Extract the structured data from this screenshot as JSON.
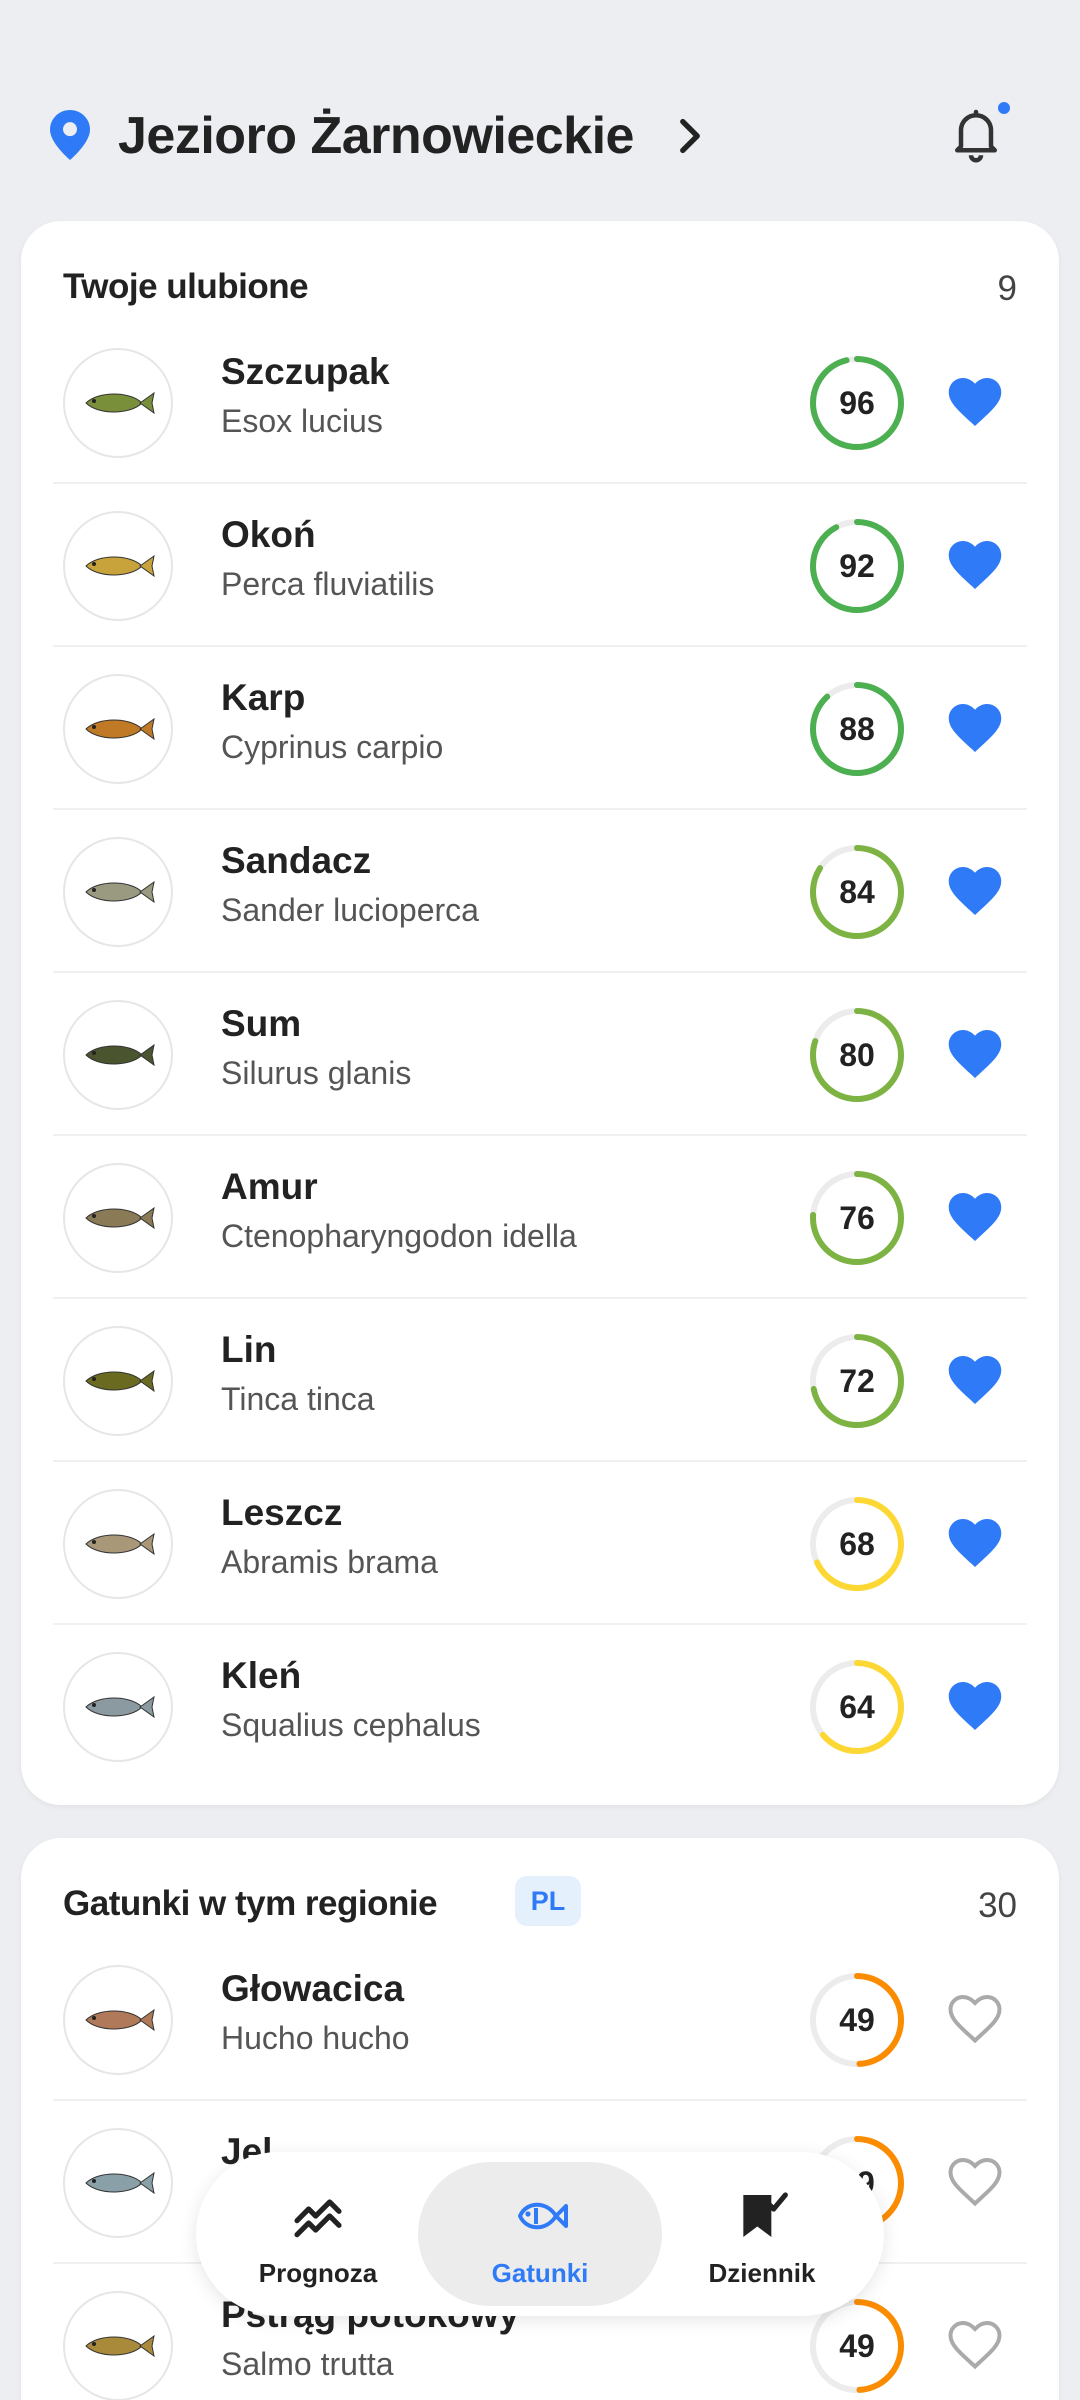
{
  "header": {
    "location": "Jezioro Żarnowieckie",
    "accent": "#2f7af7"
  },
  "favorites": {
    "title": "Twoje ulubione",
    "count": "9",
    "items": [
      {
        "name": "Szczupak",
        "latin": "Esox lucius",
        "score": 96,
        "favorite": true,
        "color": "#4caf50"
      },
      {
        "name": "Okoń",
        "latin": "Perca fluviatilis",
        "score": 92,
        "favorite": true,
        "color": "#4caf50"
      },
      {
        "name": "Karp",
        "latin": "Cyprinus carpio",
        "score": 88,
        "favorite": true,
        "color": "#4caf50"
      },
      {
        "name": "Sandacz",
        "latin": "Sander lucioperca",
        "score": 84,
        "favorite": true,
        "color": "#7cb342"
      },
      {
        "name": "Sum",
        "latin": "Silurus glanis",
        "score": 80,
        "favorite": true,
        "color": "#7cb342"
      },
      {
        "name": "Amur",
        "latin": "Ctenopharyngodon idella",
        "score": 76,
        "favorite": true,
        "color": "#7cb342"
      },
      {
        "name": "Lin",
        "latin": "Tinca tinca",
        "score": 72,
        "favorite": true,
        "color": "#7cb342"
      },
      {
        "name": "Leszcz",
        "latin": "Abramis brama",
        "score": 68,
        "favorite": true,
        "color": "#fdd835"
      },
      {
        "name": "Kleń",
        "latin": "Squalius cephalus",
        "score": 64,
        "favorite": true,
        "color": "#fdd835"
      }
    ]
  },
  "region": {
    "title": "Gatunki w tym regionie",
    "badge": "PL",
    "count": "30",
    "items": [
      {
        "name": "Głowacica",
        "latin": "Hucho hucho",
        "score": 49,
        "favorite": false,
        "color": "#fb8c00"
      },
      {
        "name": "Jel",
        "latin": "",
        "score": 49,
        "favorite": false,
        "color": "#fb8c00"
      },
      {
        "name": "Pstrąg potokowy",
        "latin": "Salmo trutta",
        "score": 49,
        "favorite": false,
        "color": "#fb8c00"
      }
    ]
  },
  "nav": {
    "items": [
      {
        "label": "Prognoza",
        "icon": "trend-chart-icon",
        "active": false
      },
      {
        "label": "Gatunki",
        "icon": "fish-icon",
        "active": true
      },
      {
        "label": "Dziennik",
        "icon": "bookmark-check-icon",
        "active": false
      }
    ]
  }
}
